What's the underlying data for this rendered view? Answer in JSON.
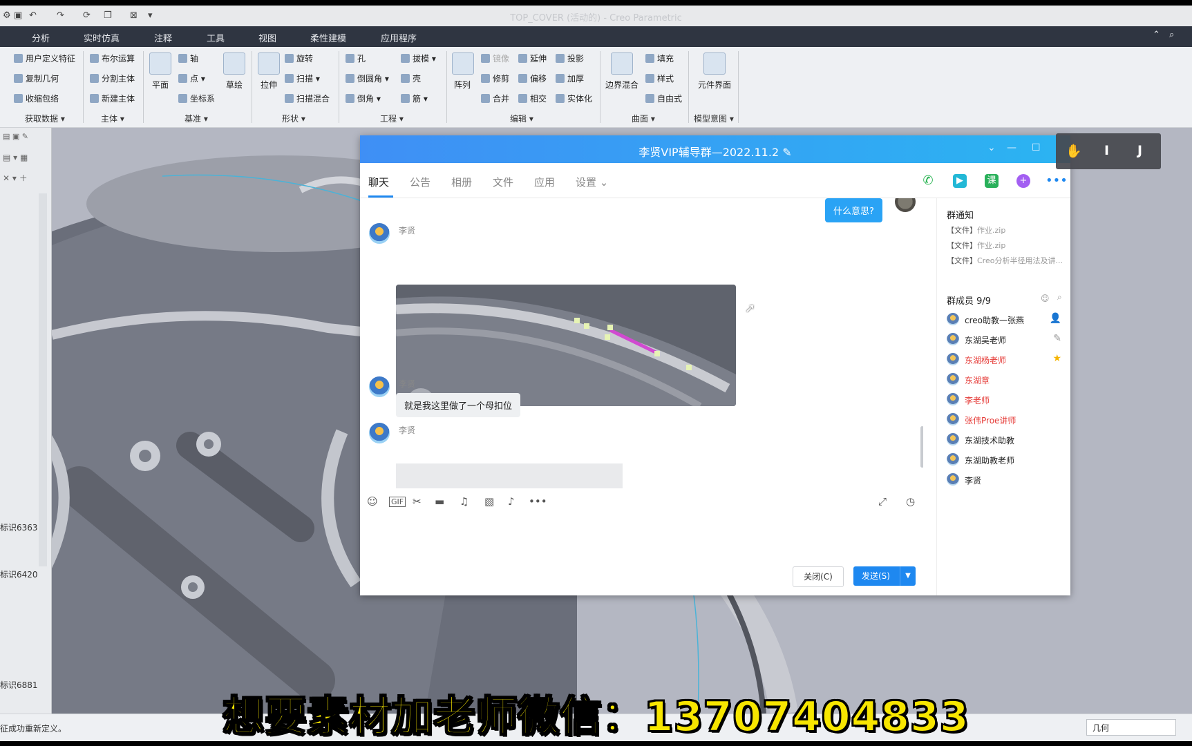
{
  "app": {
    "title": "TOP_COVER (活动的) - Creo Parametric"
  },
  "menu": {
    "tabs": [
      "分析",
      "实时仿真",
      "注释",
      "工具",
      "视图",
      "柔性建模",
      "应用程序"
    ]
  },
  "ribbon": {
    "get_data": [
      "用户定义特征",
      "复制几何",
      "收缩包络"
    ],
    "body": [
      "布尔运算",
      "分割主体",
      "新建主体"
    ],
    "datum": [
      "平面",
      "轴",
      "点",
      "坐标系",
      "草绘"
    ],
    "shapes": [
      "拉伸",
      "旋转",
      "扫描",
      "扫描混合"
    ],
    "engineering": [
      "孔",
      "倒圆角",
      "倒角",
      "拔模",
      "壳",
      "筋"
    ],
    "editing": [
      "阵列",
      "镜像",
      "修剪",
      "合并",
      "延伸",
      "偏移",
      "相交",
      "投影",
      "加厚",
      "实体化"
    ],
    "surfaces": [
      "边界混合",
      "填充",
      "样式",
      "自由式"
    ],
    "model_intent": [
      "元件界面"
    ],
    "groups": [
      "获取数据",
      "主体",
      "基准",
      "形状",
      "工程",
      "编辑",
      "曲面",
      "模型意图"
    ]
  },
  "left_panel": {
    "tree_labels": [
      "标识6363",
      "标识6420",
      "标识6881"
    ]
  },
  "status": {
    "message": "征成功重新定义。",
    "filter": "几何"
  },
  "chat": {
    "title": "李贤VIP辅导群—2022.11.2",
    "tabs": [
      "聊天",
      "公告",
      "相册",
      "文件",
      "应用",
      "设置"
    ],
    "messages": [
      {
        "sender": "",
        "text": "什么意思?",
        "mine": true
      },
      {
        "sender": "李贤",
        "type": "image"
      },
      {
        "sender": "李贤",
        "text": "就是我这里做了一个母扣位"
      },
      {
        "sender": "李贤",
        "type": "image"
      }
    ],
    "buttons": {
      "close": "关闭(C)",
      "send": "发送(S)"
    },
    "notices": {
      "title": "群通知",
      "items": [
        {
          "tag": "【文件】",
          "name": "作业.zip"
        },
        {
          "tag": "【文件】",
          "name": "作业.zip"
        },
        {
          "tag": "【文件】",
          "name": "Creo分析半径用法及讲..."
        }
      ]
    },
    "members": {
      "title": "群成员 9/9",
      "list": [
        {
          "name": "creo助教一张燕",
          "highlight": false,
          "badge": "owner"
        },
        {
          "name": "东湖吴老师",
          "highlight": false,
          "badge": "edit"
        },
        {
          "name": "东湖杨老师",
          "highlight": true,
          "badge": "star"
        },
        {
          "name": "东湖章",
          "highlight": true,
          "badge": ""
        },
        {
          "name": "李老师",
          "highlight": true,
          "badge": ""
        },
        {
          "name": "张伟Proe讲师",
          "highlight": true,
          "badge": ""
        },
        {
          "name": "东湖技术助教",
          "highlight": false,
          "badge": ""
        },
        {
          "name": "东湖助教老师",
          "highlight": false,
          "badge": ""
        },
        {
          "name": "李贤",
          "highlight": false,
          "badge": ""
        }
      ]
    }
  },
  "float_tools": [
    "I",
    "J"
  ],
  "caption": "想要素材加老师微信：13707404833",
  "colors": {
    "chat_title_from": "#3f8ff5",
    "chat_title_to": "#2bb4f2",
    "send_button": "#1e88f0",
    "member_highlight": "#e53935",
    "caption": "#f7e600",
    "viewport": "#b4b7c2"
  }
}
